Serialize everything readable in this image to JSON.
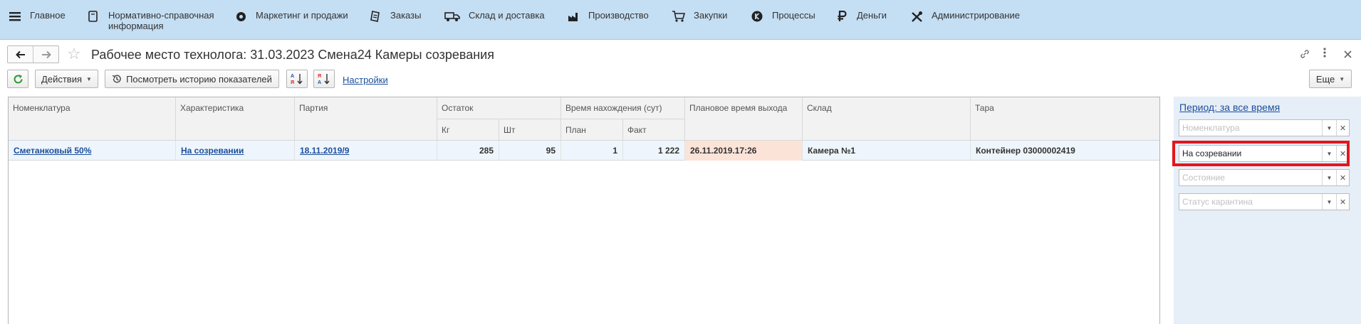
{
  "sections": [
    {
      "label": "Главное",
      "icon": "menu-icon"
    },
    {
      "label": "Нормативно-справочная информация",
      "icon": "reference-book-icon"
    },
    {
      "label": "Маркетинг и продажи",
      "icon": "marketing-icon"
    },
    {
      "label": "Заказы",
      "icon": "orders-icon"
    },
    {
      "label": "Склад и доставка",
      "icon": "truck-icon"
    },
    {
      "label": "Производство",
      "icon": "factory-icon"
    },
    {
      "label": "Закупки",
      "icon": "cart-icon"
    },
    {
      "label": "Процессы",
      "icon": "processes-icon"
    },
    {
      "label": "Деньги",
      "icon": "ruble-icon"
    },
    {
      "label": "Администрирование",
      "icon": "tools-icon"
    }
  ],
  "form": {
    "title": "Рабочее место технолога: 31.03.2023 Смена24 Камеры созревания",
    "back_glyph": "🡐",
    "forward_glyph": "🡒"
  },
  "toolbar": {
    "actions_label": "Действия",
    "history_label": "Посмотреть историю показателей",
    "settings_link": "Настройки",
    "more_label": "Еще"
  },
  "table": {
    "headers": {
      "nomenclature": "Номенклатура",
      "characteristic": "Характеристика",
      "batch": "Партия",
      "remainder": "Остаток",
      "kg": "Кг",
      "pcs": "Шт",
      "time_in_place": "Время нахождения (сут)",
      "plan": "План",
      "fact": "Факт",
      "planned_exit": "Плановое время выхода",
      "warehouse": "Склад",
      "container": "Тара"
    },
    "rows": [
      {
        "nomenclature": "Сметанковый 50%",
        "characteristic": "На созревании",
        "batch": "18.11.2019/9",
        "kg": "285",
        "pcs": "95",
        "plan": "1",
        "fact": "1 222",
        "planned_exit": "26.11.2019.17:26",
        "warehouse": "Камера №1",
        "container": "Контейнер 03000002419"
      }
    ]
  },
  "filters": {
    "period_link": "Период: за все время",
    "nomenclature_placeholder": "Номенклатура",
    "characteristic_value": "На созревании",
    "state_placeholder": "Состояние",
    "quarantine_placeholder": "Статус карантина"
  },
  "colors": {
    "section_bar": "#c4def3",
    "link": "#1c4f9c",
    "highlight_cell": "#fbe3d8",
    "annotation_box": "#e3161d",
    "filter_panel": "#e6eef8"
  }
}
